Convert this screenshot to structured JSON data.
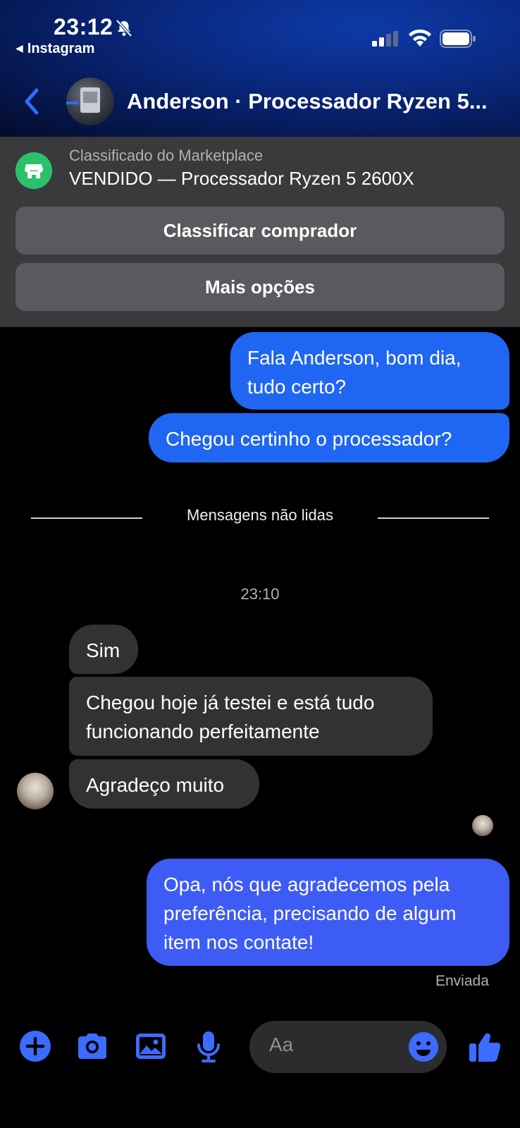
{
  "status_bar": {
    "time": "23:12",
    "back_app": "Instagram"
  },
  "header": {
    "title": "Anderson · Processador Ryzen 5..."
  },
  "marketplace": {
    "subtitle": "Classificado do Marketplace",
    "listing": "VENDIDO — Processador Ryzen 5 2600X",
    "rate_button": "Classificar comprador",
    "more_button": "Mais opções"
  },
  "messages": {
    "m1": "Fala Anderson, bom dia, tudo certo?",
    "m2": "Chegou certinho o processador?",
    "unread_label": "Mensagens não lidas",
    "timestamp": "23:10",
    "r1": "Sim",
    "r2": "Chegou hoje já testei e está tudo funcionando perfeitamente",
    "r3": "Agradeço muito",
    "m3": "Opa, nós que agradecemos pela preferência, precisando de algum item nos contate!",
    "status": "Enviada"
  },
  "composer": {
    "placeholder": "Aa"
  },
  "colors": {
    "accent": "#1f66f2",
    "icon_blue": "#3b6cff",
    "incoming": "#323234"
  },
  "icons": [
    "bell-slash-icon",
    "signal-icon",
    "wifi-icon",
    "battery-icon",
    "back-chevron-icon",
    "shop-icon",
    "plus-icon",
    "camera-icon",
    "image-icon",
    "mic-icon",
    "emoji-icon",
    "thumbs-up-icon"
  ]
}
